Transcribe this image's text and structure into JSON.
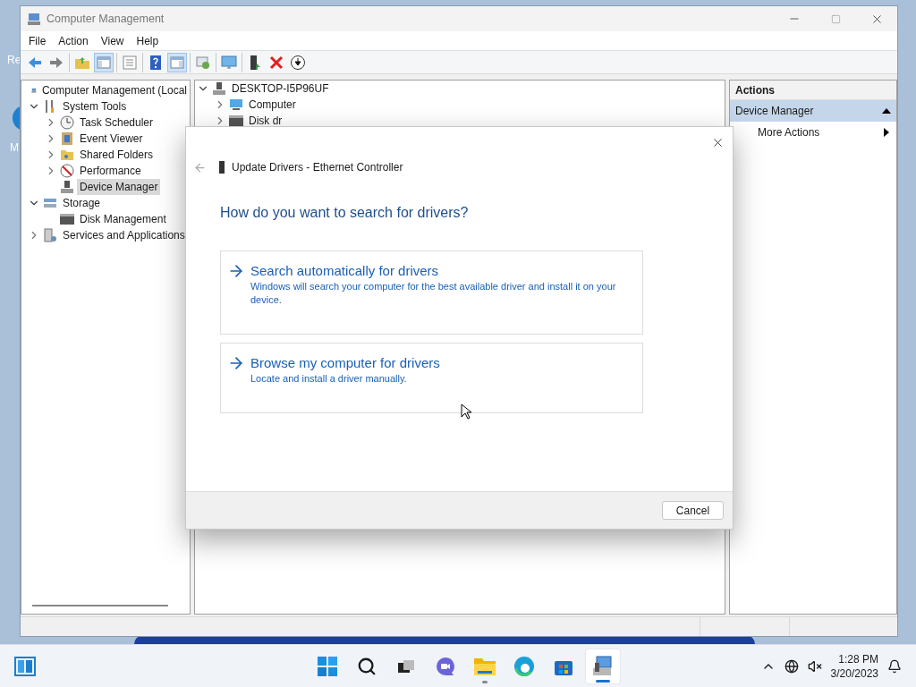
{
  "desktop": {
    "icon_labels": [
      "Re",
      "M"
    ]
  },
  "window": {
    "title": "Computer Management",
    "menu": [
      "File",
      "Action",
      "View",
      "Help"
    ],
    "toolbar": [
      [
        {
          "kind": "back",
          "pressed": false
        },
        {
          "kind": "forward",
          "pressed": false
        }
      ],
      [
        {
          "kind": "folder-up",
          "pressed": false
        },
        {
          "kind": "tree-pane",
          "pressed": true
        }
      ],
      [
        {
          "kind": "properties",
          "pressed": false
        }
      ],
      [
        {
          "kind": "help",
          "pressed": false
        },
        {
          "kind": "action-pane",
          "pressed": true
        }
      ],
      [
        {
          "kind": "scan",
          "pressed": false
        }
      ],
      [
        {
          "kind": "monitor",
          "pressed": false
        }
      ],
      [
        {
          "kind": "update-driver",
          "pressed": false
        },
        {
          "kind": "uninstall",
          "pressed": false
        },
        {
          "kind": "download",
          "pressed": false
        }
      ]
    ],
    "tree": [
      {
        "label": "Computer Management (Local",
        "kind": "computer",
        "selected": false,
        "children": [
          {
            "label": "System Tools",
            "kind": "tools",
            "expanded": true,
            "selected": false,
            "children": [
              {
                "label": "Task Scheduler",
                "kind": "clock",
                "expanded": false,
                "selected": false
              },
              {
                "label": "Event Viewer",
                "kind": "log",
                "expanded": false,
                "selected": false
              },
              {
                "label": "Shared Folders",
                "kind": "folder",
                "expanded": false,
                "selected": false
              },
              {
                "label": "Performance",
                "kind": "gauge",
                "expanded": false,
                "selected": false
              },
              {
                "label": "Device Manager",
                "kind": "device",
                "selected": true
              }
            ]
          },
          {
            "label": "Storage",
            "kind": "storage",
            "expanded": true,
            "selected": false,
            "children": [
              {
                "label": "Disk Management",
                "kind": "disk",
                "selected": false
              }
            ]
          },
          {
            "label": "Services and Applications",
            "kind": "services",
            "expanded": false,
            "selected": false
          }
        ]
      }
    ],
    "devices": [
      {
        "label": "DESKTOP-I5P96UF",
        "kind": "device",
        "expanded": true,
        "children": [
          {
            "label": "Computer",
            "kind": "monitor",
            "expanded": false
          },
          {
            "label": "Disk dr",
            "kind": "disk",
            "expanded": false
          }
        ]
      }
    ],
    "actions": {
      "title": "Actions",
      "sections": [
        {
          "label": "Device Manager",
          "expanded": true,
          "items": [
            "More Actions"
          ]
        }
      ]
    }
  },
  "dialog": {
    "title": "Update Drivers - Ethernet Controller",
    "heading": "How do you want to search for drivers?",
    "options": [
      {
        "title": "Search automatically for drivers",
        "description": "Windows will search your computer for the best available driver and install it on your device."
      },
      {
        "title": "Browse my computer for drivers",
        "description": "Locate and install a driver manually."
      }
    ],
    "buttons": [
      "Cancel"
    ]
  },
  "taskbar": {
    "apps": [
      {
        "kind": "start",
        "running": false,
        "selected": false
      },
      {
        "kind": "search",
        "running": false,
        "selected": false
      },
      {
        "kind": "task-view",
        "running": false,
        "selected": false
      },
      {
        "kind": "chat",
        "running": false,
        "selected": false
      },
      {
        "kind": "explorer",
        "running": true,
        "selected": false
      },
      {
        "kind": "edge",
        "running": false,
        "selected": false
      },
      {
        "kind": "store",
        "running": false,
        "selected": false
      },
      {
        "kind": "computer-management",
        "running": true,
        "selected": true
      }
    ],
    "time": "1:28 PM",
    "date": "3/20/2023"
  }
}
